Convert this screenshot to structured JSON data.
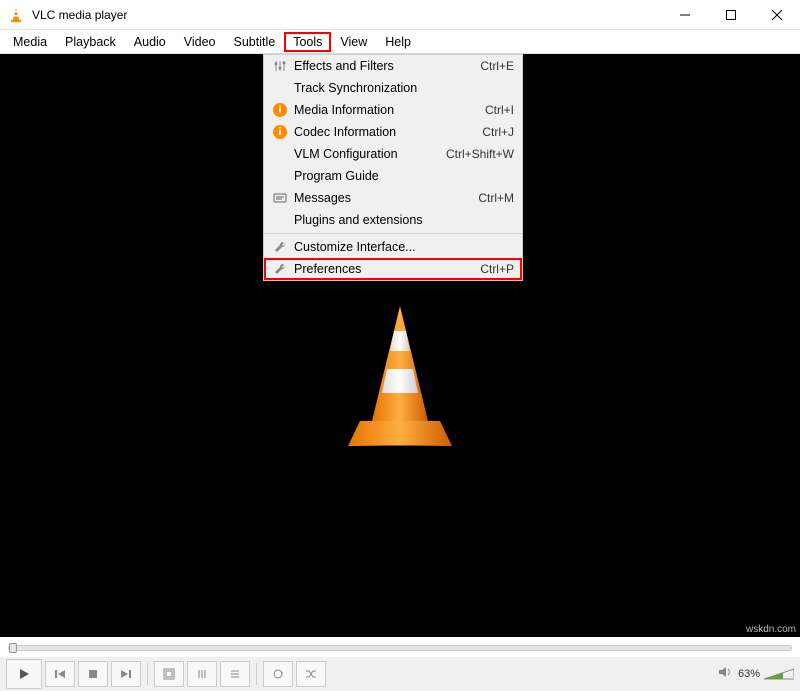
{
  "titlebar": {
    "title": "VLC media player"
  },
  "menu": {
    "items": [
      "Media",
      "Playback",
      "Audio",
      "Video",
      "Subtitle",
      "Tools",
      "View",
      "Help"
    ],
    "active_index": 5
  },
  "tools_menu": {
    "items": [
      {
        "icon": "sliders",
        "label": "Effects and Filters",
        "shortcut": "Ctrl+E"
      },
      {
        "icon": "",
        "label": "Track Synchronization",
        "shortcut": ""
      },
      {
        "icon": "info",
        "label": "Media Information",
        "shortcut": "Ctrl+I"
      },
      {
        "icon": "info",
        "label": "Codec Information",
        "shortcut": "Ctrl+J"
      },
      {
        "icon": "",
        "label": "VLM Configuration",
        "shortcut": "Ctrl+Shift+W"
      },
      {
        "icon": "",
        "label": "Program Guide",
        "shortcut": ""
      },
      {
        "icon": "msg",
        "label": "Messages",
        "shortcut": "Ctrl+M"
      },
      {
        "icon": "",
        "label": "Plugins and extensions",
        "shortcut": ""
      },
      {
        "sep": true
      },
      {
        "icon": "wrench",
        "label": "Customize Interface...",
        "shortcut": ""
      },
      {
        "icon": "wrench",
        "label": "Preferences",
        "shortcut": "Ctrl+P",
        "highlight": true
      }
    ]
  },
  "controls": {
    "volume_text": "63%"
  },
  "watermark": "wskdn.com"
}
